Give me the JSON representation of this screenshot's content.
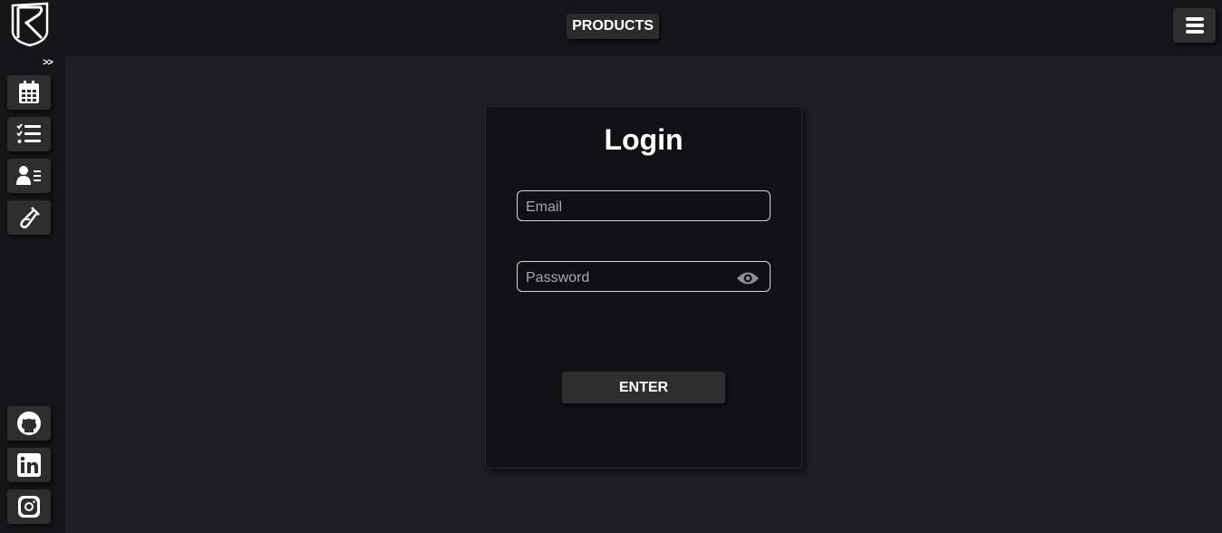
{
  "header": {
    "products_label": "PRODUCTS"
  },
  "sidebar": {
    "expand_label": ">>",
    "top_items": [
      {
        "icon": "calendar-icon"
      },
      {
        "icon": "checklist-icon"
      },
      {
        "icon": "contact-card-icon"
      },
      {
        "icon": "test-tube-icon"
      }
    ],
    "bottom_items": [
      {
        "icon": "github-icon"
      },
      {
        "icon": "linkedin-icon"
      },
      {
        "icon": "instagram-icon"
      }
    ]
  },
  "login": {
    "title": "Login",
    "email_placeholder": "Email",
    "password_placeholder": "Password",
    "enter_label": "ENTER"
  },
  "colors": {
    "background": "#1d1f25",
    "bars": "#14161a",
    "card": "#111216",
    "button": "#2e2e30"
  }
}
